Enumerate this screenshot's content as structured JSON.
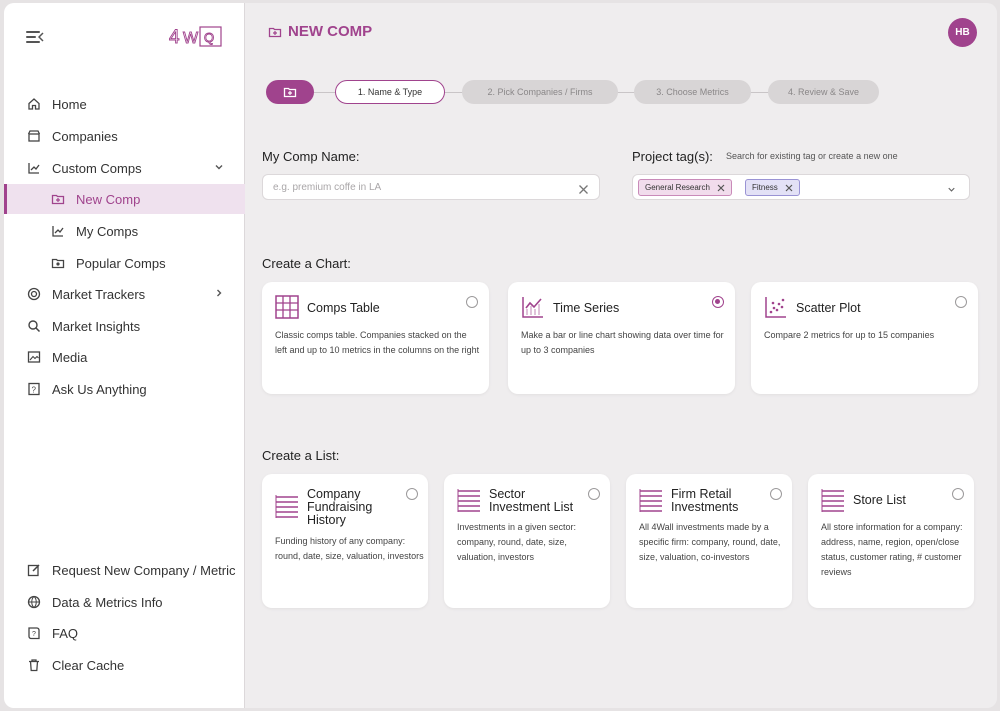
{
  "brand": {
    "logo_text": "4WQ",
    "accent_color": "#a0438d"
  },
  "sidebar": {
    "menu_icon": "collapse-menu-icon",
    "items": [
      {
        "label": "Home",
        "icon": "home-icon"
      },
      {
        "label": "Companies",
        "icon": "building-icon"
      },
      {
        "label": "Custom Comps",
        "icon": "chart-icon",
        "expanded": true
      },
      {
        "label": "New Comp",
        "icon": "folder-plus-icon",
        "active": true
      },
      {
        "label": "My Comps",
        "icon": "chart-icon"
      },
      {
        "label": "Popular Comps",
        "icon": "folder-star-icon"
      },
      {
        "label": "Market Trackers",
        "icon": "target-icon"
      },
      {
        "label": "Market Insights",
        "icon": "search-icon"
      },
      {
        "label": "Media",
        "icon": "image-icon"
      },
      {
        "label": "Ask Us Anything",
        "icon": "question-icon"
      }
    ],
    "bottom_items": [
      {
        "label": "Request New Company / Metric",
        "icon": "edit-icon"
      },
      {
        "label": "Data & Metrics Info",
        "icon": "globe-icon"
      },
      {
        "label": "FAQ",
        "icon": "book-icon"
      },
      {
        "label": "Clear Cache",
        "icon": "trash-icon"
      }
    ]
  },
  "header": {
    "title": "NEW COMP",
    "avatar_initials": "HB"
  },
  "stepper": {
    "steps": [
      {
        "label": "1. Name & Type",
        "state": "current"
      },
      {
        "label": "2. Pick Companies / Firms",
        "state": "pending"
      },
      {
        "label": "3. Choose Metrics",
        "state": "pending"
      },
      {
        "label": "4. Review & Save",
        "state": "pending"
      }
    ]
  },
  "form": {
    "comp_name_label": "My Comp Name:",
    "comp_name_placeholder": "e.g. premium coffe in LA",
    "project_tags_label": "Project tag(s):",
    "project_tags_hint": "Search for existing tag or create a new one",
    "tags": [
      "General Research",
      "Fitness"
    ]
  },
  "charts": {
    "title": "Create a Chart:",
    "options": [
      {
        "title": "Comps Table",
        "description": "Classic comps table. Companies stacked on the left and up to 10 metrics in the columns on the right",
        "selected": false
      },
      {
        "title": "Time Series",
        "description": "Make a bar or line chart showing data over time for up to 3 companies",
        "selected": true
      },
      {
        "title": "Scatter Plot",
        "description": "Compare 2 metrics for up to 15 companies",
        "selected": false
      }
    ]
  },
  "lists": {
    "title": "Create a List:",
    "options": [
      {
        "title": "Company Fundraising History",
        "description": "Funding history of any company: round, date, size, valuation, investors",
        "selected": false
      },
      {
        "title": "Sector Investment List",
        "description": "Investments in a given sector: company, round, date, size, valuation, investors",
        "selected": false
      },
      {
        "title": "Firm Retail Investments",
        "description": "All 4Wall investments made by a specific firm: company, round, date, size, valuation, co-investors",
        "selected": false
      },
      {
        "title": "Store List",
        "description": "All store information for a company: address, name, region, open/close status, customer rating, # customer reviews",
        "selected": false
      }
    ]
  }
}
